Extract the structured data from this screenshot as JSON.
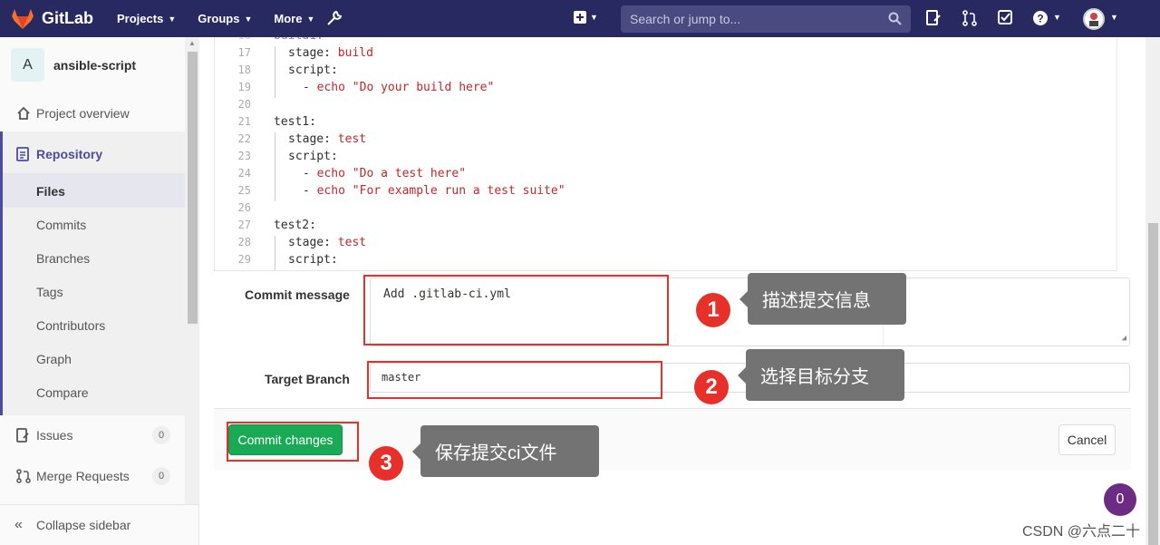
{
  "navbar": {
    "brand": "GitLab",
    "projects": "Projects",
    "groups": "Groups",
    "more": "More",
    "search_placeholder": "Search or jump to..."
  },
  "sidebar": {
    "project_initial": "A",
    "project_name": "ansible-script",
    "items": [
      {
        "label": "Project overview"
      },
      {
        "label": "Repository"
      },
      {
        "label": "Files"
      },
      {
        "label": "Commits"
      },
      {
        "label": "Branches"
      },
      {
        "label": "Tags"
      },
      {
        "label": "Contributors"
      },
      {
        "label": "Graph"
      },
      {
        "label": "Compare"
      },
      {
        "label": "Issues",
        "count": "0"
      },
      {
        "label": "Merge Requests",
        "count": "0"
      }
    ],
    "collapse": "Collapse sidebar"
  },
  "editor": {
    "lines": [
      {
        "n": "17",
        "key": "stage: ",
        "val": "build"
      },
      {
        "n": "18",
        "key": "script:",
        "val": ""
      },
      {
        "n": "19",
        "key": "- ",
        "val": "echo \"Do your build here\""
      },
      {
        "n": "20",
        "key": "",
        "val": ""
      },
      {
        "n": "21",
        "key": "test1:",
        "val": ""
      },
      {
        "n": "22",
        "key": "stage: ",
        "val": "test"
      },
      {
        "n": "23",
        "key": "script:",
        "val": ""
      },
      {
        "n": "24",
        "key": "- ",
        "val": "echo \"Do a test here\""
      },
      {
        "n": "25",
        "key": "- ",
        "val": "echo \"For example run a test suite\""
      },
      {
        "n": "26",
        "key": "",
        "val": ""
      },
      {
        "n": "27",
        "key": "test2:",
        "val": ""
      },
      {
        "n": "28",
        "key": "stage: ",
        "val": "test"
      },
      {
        "n": "29",
        "key": "script:",
        "val": ""
      }
    ]
  },
  "form": {
    "commit_message_label": "Commit message",
    "commit_message_value": "Add .gitlab-ci.yml",
    "target_branch_label": "Target Branch",
    "target_branch_value": "master",
    "commit_button": "Commit changes",
    "cancel_button": "Cancel"
  },
  "annotations": {
    "n1": "1",
    "tip1": "描述提交信息",
    "n2": "2",
    "tip2": "选择目标分支",
    "n3": "3",
    "tip3": "保存提交ci文件"
  },
  "help_count": "0",
  "watermark": "CSDN @六点二十"
}
